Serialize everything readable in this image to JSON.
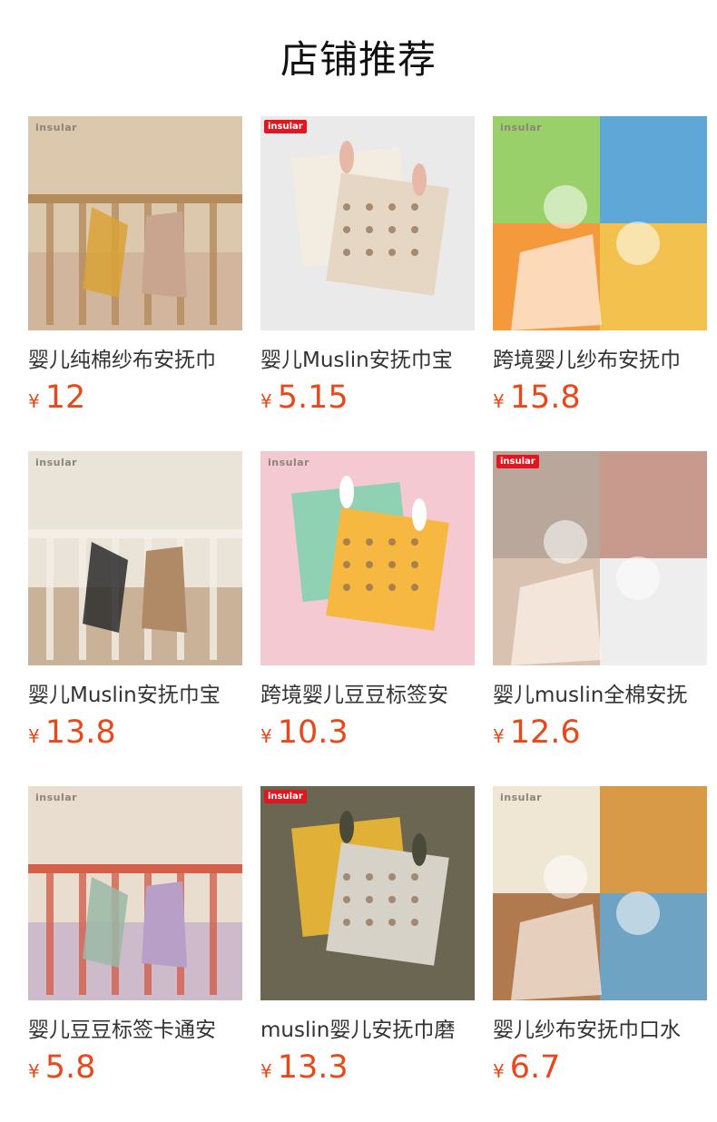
{
  "section": {
    "title": "店铺推荐"
  },
  "currency": "¥",
  "products": [
    {
      "name": "婴儿纯棉纱布安抚巾",
      "price": "12",
      "brand": "insular",
      "tag": "",
      "colors": [
        "#dcc9ad",
        "#b58b5c",
        "#c9a58f",
        "#d9a236"
      ]
    },
    {
      "name": "婴儿Muslin安抚巾宝",
      "price": "5.15",
      "brand": "",
      "tag": "insular",
      "colors": [
        "#ebeaea",
        "#f3ece0",
        "#e6d7c4",
        "#e7b8a8"
      ]
    },
    {
      "name": "跨境婴儿纱布安抚巾",
      "price": "15.8",
      "brand": "insular",
      "tag": "",
      "colors": [
        "#9ad06a",
        "#5fa7d6",
        "#f59a3c",
        "#f2c14e"
      ]
    },
    {
      "name": "婴儿Muslin安抚巾宝",
      "price": "13.8",
      "brand": "insular",
      "tag": "",
      "colors": [
        "#e9e3d8",
        "#f4efe6",
        "#b08a66",
        "#2b2b2b"
      ]
    },
    {
      "name": "跨境婴儿豆豆标签安",
      "price": "10.3",
      "brand": "insular",
      "tag": "",
      "colors": [
        "#f4c9d2",
        "#8fd1b2",
        "#f7b842",
        "#ffffff"
      ]
    },
    {
      "name": "婴儿muslin全棉安抚",
      "price": "12.6",
      "brand": "",
      "tag": "insular",
      "colors": [
        "#b9a79b",
        "#c89a8d",
        "#d9c3b0",
        "#eeeeee"
      ]
    },
    {
      "name": "婴儿豆豆标签卡通安",
      "price": "5.8",
      "brand": "insular",
      "tag": "",
      "colors": [
        "#e9ddd0",
        "#d3604a",
        "#b79fc7",
        "#9ab8a6"
      ]
    },
    {
      "name": "muslin婴儿安抚巾磨",
      "price": "13.3",
      "brand": "",
      "tag": "insular",
      "colors": [
        "#6b6652",
        "#e1b137",
        "#d7d2c7",
        "#4a4a3a"
      ]
    },
    {
      "name": "婴儿纱布安抚巾口水",
      "price": "6.7",
      "brand": "insular",
      "tag": "",
      "colors": [
        "#efe7d4",
        "#d89a47",
        "#b07a4e",
        "#6fa3c4"
      ]
    }
  ]
}
